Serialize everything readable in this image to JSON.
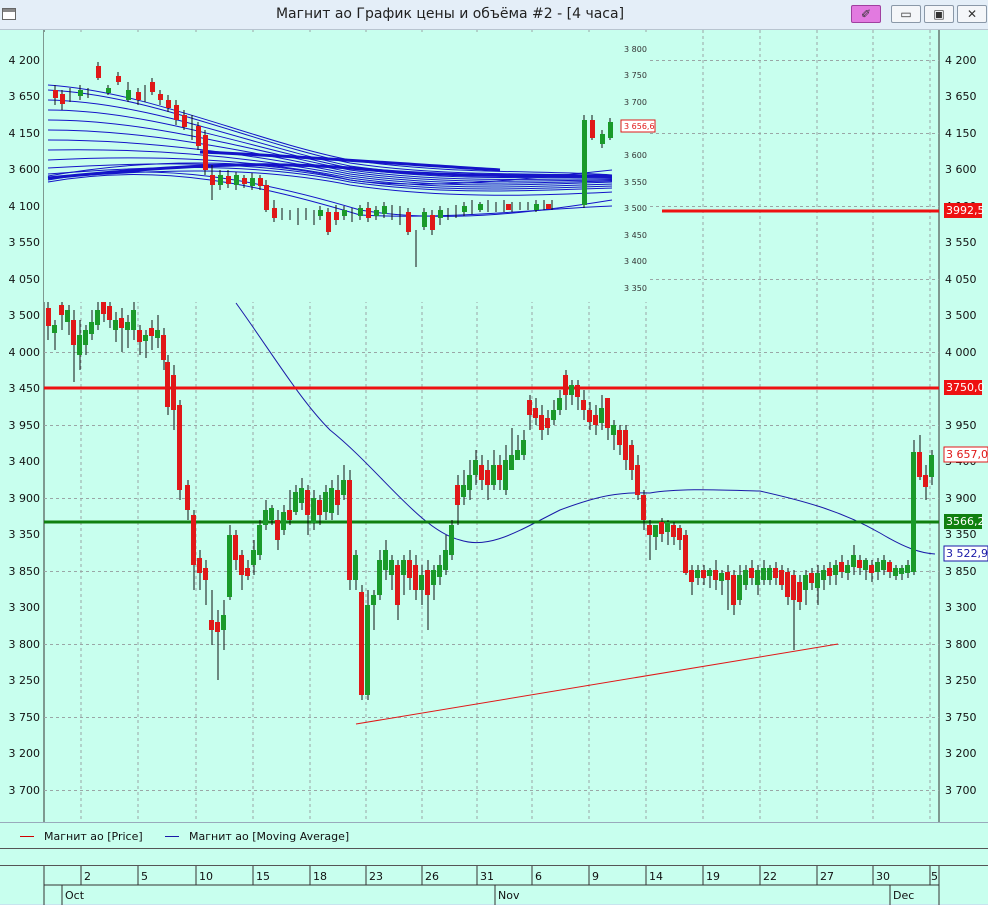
{
  "window": {
    "title": "Магнит ао График цены и объёма #2 - [4 часа]",
    "pin_glyph": "✐",
    "minimize_glyph": "▭",
    "maximize_glyph": "▣",
    "close_glyph": "✕"
  },
  "price_axis": {
    "ticks": [
      "4 200",
      "4 150",
      "4 100",
      "4 050",
      "4 000",
      "3 950",
      "3 900",
      "3 850",
      "3 800",
      "3 750",
      "3 700",
      "3 650",
      "3 600",
      "3 550",
      "3 500",
      "3 450",
      "3 400",
      "3 350",
      "3 300",
      "3 250",
      "3 200"
    ]
  },
  "markers": {
    "level_high": "3750,0",
    "level_support": "3566,2",
    "level_top": "3992,5",
    "last_price": "3 657,0",
    "moving_average": "3 522,9"
  },
  "inset": {
    "ticks": [
      "3 800",
      "3 750",
      "3 700",
      "3 650",
      "3 600",
      "3 550",
      "3 500",
      "3 450",
      "3 400",
      "3 350"
    ],
    "price_tag": "3 656,6"
  },
  "legend": {
    "price_label": "Магнит ао [Price]",
    "ma_label": "Магнит ао [Moving Average]",
    "price_color": "#d00000",
    "ma_color": "#1a1aa8"
  },
  "time_axis": {
    "days": [
      "2",
      "5",
      "10",
      "15",
      "18",
      "23",
      "26",
      "31",
      "6",
      "9",
      "14",
      "19",
      "22",
      "27",
      "30",
      "5"
    ],
    "months": [
      "Oct",
      "Nov",
      "Dec"
    ]
  },
  "colors": {
    "background": "#c8ffee",
    "up_candle": "#1a9a2a",
    "down_candle": "#e01818",
    "grid": "#9aa6a6"
  }
}
